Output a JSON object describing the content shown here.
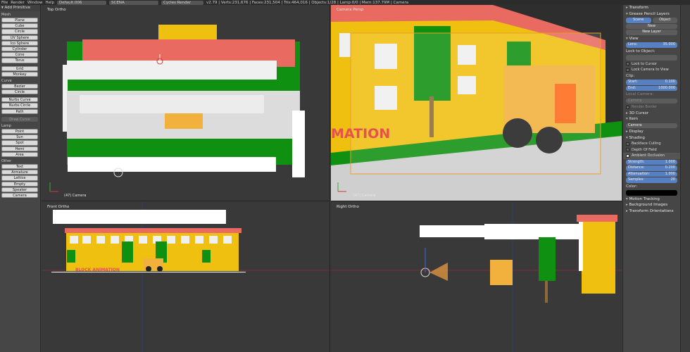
{
  "topbar": {
    "menus": [
      "File",
      "Render",
      "Window",
      "Help"
    ],
    "layout": "Default.006",
    "scene": "SCENA",
    "engine": "Cycles Render",
    "stats": "v2.79 | Verts:231,676 | Faces:231,504 | Tris:464,016 | Objects:1/28 | Lamp:0/0 | Mem:137.79M | Camera"
  },
  "left_panel": {
    "header": "Add Primitive",
    "sections": [
      {
        "title": "Mesh",
        "items": [
          "Plane",
          "Cube",
          "Circle",
          "UV Sphere",
          "Ico Sphere",
          "Cylinder",
          "Cone",
          "Torus"
        ]
      },
      {
        "title": "",
        "items": [
          "Grid",
          "Monkey"
        ]
      },
      {
        "title": "Curve",
        "items": [
          "Bezier",
          "Circle"
        ]
      },
      {
        "title": "",
        "items": [
          "Nurbs Curve",
          "Nurbs Circle",
          "Path"
        ]
      },
      {
        "title": "",
        "items": [
          "Draw Curve"
        ]
      },
      {
        "title": "Lamp",
        "items": [
          "Point",
          "Sun",
          "Spot",
          "Hemi",
          "Area"
        ]
      },
      {
        "title": "Other",
        "items": [
          "Text",
          "Armature",
          "Lattice",
          "Empty",
          "Speaker",
          "Camera"
        ]
      }
    ]
  },
  "viewports": {
    "top_left": {
      "label": "Top Ortho",
      "camera": "(47) Camera"
    },
    "top_right": {
      "label": "Camera Persp",
      "camera": "(47) Camera",
      "text": "MATION"
    },
    "bottom_left": {
      "label": "Front Ortho",
      "text": "BLOCK ANIMATION"
    },
    "bottom_right": {
      "label": "Right Ortho"
    }
  },
  "right_panel": {
    "transform": "Transform",
    "gp_layers": "Grease Pencil Layers",
    "scene_btn": "Scene",
    "object_btn": "Object",
    "new_btn": "New",
    "new_layer_btn": "New Layer",
    "view": "View",
    "lens_label": "Lens:",
    "lens_value": "35.000",
    "lock_to_object": "Lock to Object:",
    "lock_to_cursor": "Lock to Cursor",
    "lock_camera": "Lock Camera to View",
    "clip": "Clip:",
    "clip_start_label": "Start:",
    "clip_start": "0.100",
    "clip_end_label": "End:",
    "clip_end": "1000.000",
    "local_camera": "Local Camera:",
    "camera_field": "Camera",
    "render_border": "Render Border",
    "cursor_3d": "3D Cursor",
    "item": "Item",
    "item_name": "Camera",
    "display": "Display",
    "shading": "Shading",
    "backface": "Backface Culling",
    "dof": "Depth Of Field",
    "ao": "Ambient Occlusion",
    "strength_label": "Strength:",
    "strength": "1.000",
    "distance_label": "Distance:",
    "distance": "0.200",
    "attenuation_label": "Attenuation:",
    "attenuation": "1.000",
    "samples_label": "Samples:",
    "samples": "20",
    "color_label": "Color:",
    "motion_tracking": "Motion Tracking",
    "bg_images": "Background Images",
    "transform_orient": "Transform Orientations"
  },
  "colors": {
    "yellow": "#f0c010",
    "green": "#109010",
    "red": "#e86060",
    "orange": "#ff6a1a"
  }
}
